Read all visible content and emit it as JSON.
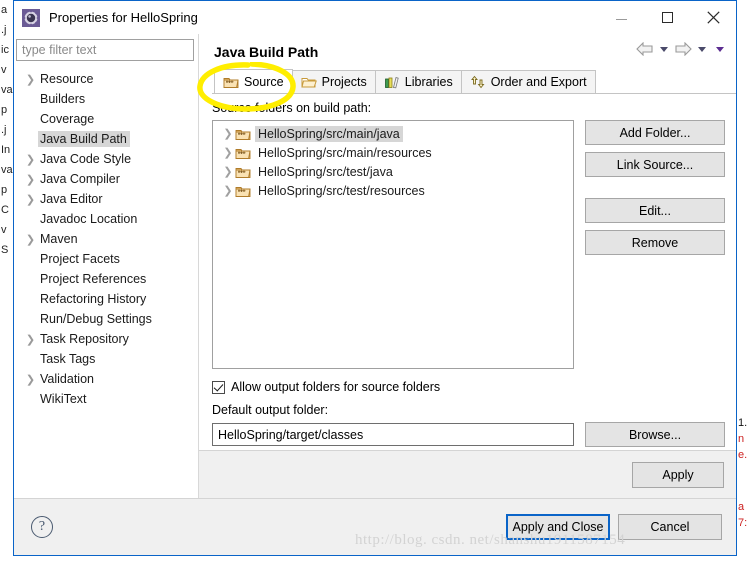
{
  "window": {
    "title": "Properties for HelloSpring",
    "icon": "eclipse-properties-icon",
    "minimize_label": "Minimize",
    "maximize_label": "Maximize",
    "close_label": "Close"
  },
  "sidebar": {
    "filter": {
      "placeholder": "type filter text",
      "value": ""
    },
    "items": [
      {
        "label": "Resource",
        "expandable": true,
        "selected": false
      },
      {
        "label": "Builders",
        "expandable": false,
        "selected": false
      },
      {
        "label": "Coverage",
        "expandable": false,
        "selected": false
      },
      {
        "label": "Java Build Path",
        "expandable": false,
        "selected": true
      },
      {
        "label": "Java Code Style",
        "expandable": true,
        "selected": false
      },
      {
        "label": "Java Compiler",
        "expandable": true,
        "selected": false
      },
      {
        "label": "Java Editor",
        "expandable": true,
        "selected": false
      },
      {
        "label": "Javadoc Location",
        "expandable": false,
        "selected": false
      },
      {
        "label": "Maven",
        "expandable": true,
        "selected": false
      },
      {
        "label": "Project Facets",
        "expandable": false,
        "selected": false
      },
      {
        "label": "Project References",
        "expandable": false,
        "selected": false
      },
      {
        "label": "Refactoring History",
        "expandable": false,
        "selected": false
      },
      {
        "label": "Run/Debug Settings",
        "expandable": false,
        "selected": false
      },
      {
        "label": "Task Repository",
        "expandable": true,
        "selected": false
      },
      {
        "label": "Task Tags",
        "expandable": false,
        "selected": false
      },
      {
        "label": "Validation",
        "expandable": true,
        "selected": false
      },
      {
        "label": "WikiText",
        "expandable": false,
        "selected": false
      }
    ]
  },
  "content": {
    "page_title": "Java Build Path",
    "nav": {
      "back_label": "Back",
      "forward_label": "Forward",
      "menu_label": "View Menu"
    },
    "tabs": [
      {
        "label": "Source",
        "icon": "source-folder-icon",
        "active": true
      },
      {
        "label": "Projects",
        "icon": "open-folder-icon",
        "active": false
      },
      {
        "label": "Libraries",
        "icon": "books-icon",
        "active": false
      },
      {
        "label": "Order and Export",
        "icon": "order-arrows-icon",
        "active": false
      }
    ],
    "source_tab": {
      "list_label": "Source folders on build path:",
      "folders": [
        {
          "path": "HelloSpring/src/main/java",
          "selected": true
        },
        {
          "path": "HelloSpring/src/main/resources",
          "selected": false
        },
        {
          "path": "HelloSpring/src/test/java",
          "selected": false
        },
        {
          "path": "HelloSpring/src/test/resources",
          "selected": false
        }
      ],
      "buttons": [
        {
          "label": "Add Folder...",
          "enabled": true
        },
        {
          "label": "Link Source...",
          "enabled": true
        },
        {
          "label": "Edit...",
          "enabled": true
        },
        {
          "label": "Remove",
          "enabled": true
        }
      ],
      "allow_output_checkbox": {
        "label": "Allow output folders for source folders",
        "checked": true
      },
      "default_output_label": "Default output folder:",
      "default_output_value": "HelloSpring/target/classes",
      "browse_label": "Browse..."
    },
    "apply_label": "Apply"
  },
  "footer": {
    "help_label": "?",
    "apply_and_close_label": "Apply and Close",
    "cancel_label": "Cancel"
  },
  "watermark": "http://blog. csdn. net/shanshu1911587154",
  "background_edges": {
    "left_fragments": [
      "a",
      "",
      "",
      "",
      "",
      ".j",
      "ic",
      "",
      "v",
      "va",
      "p",
      ".j",
      "In",
      "va",
      "p",
      "C",
      "v",
      "",
      "",
      "S"
    ],
    "right_fragments": [
      "1.",
      "n",
      "e.",
      "",
      "a",
      "7:"
    ]
  },
  "colors": {
    "accent_blue": "#0a64c8",
    "dialog_bg": "#f0f0f0",
    "selection_grey": "#d6d6d6",
    "annotation_yellow": "#ffee00",
    "watermark_grey": "#d3d3d3"
  }
}
